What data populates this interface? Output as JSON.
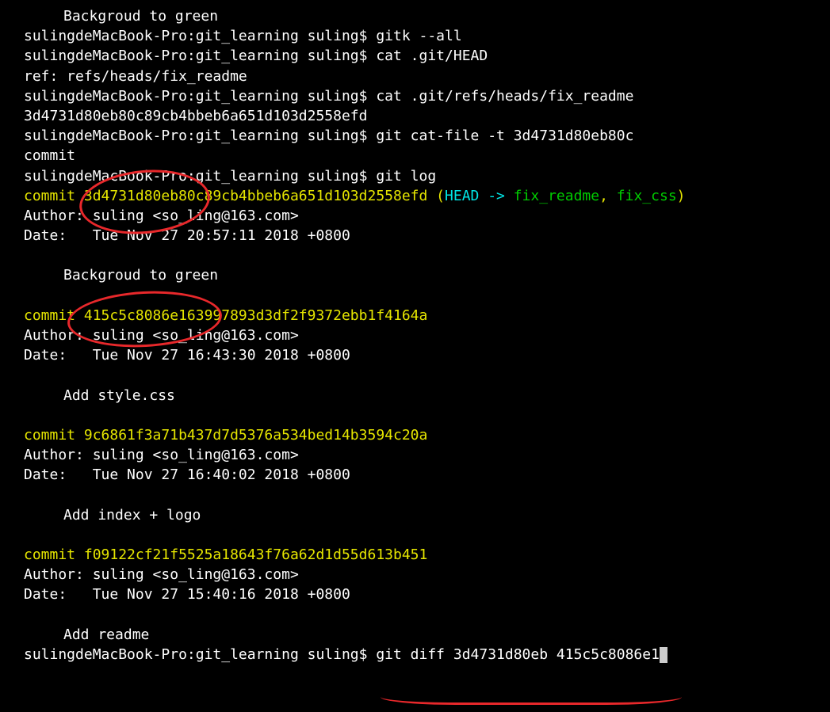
{
  "prompt": "sulingdeMacBook-Pro:git_learning suling$ ",
  "lines": {
    "l0_msg": "Backgroud to green",
    "l1_cmd": "gitk --all",
    "l2_cmd": "cat .git/HEAD",
    "l3": "ref: refs/heads/fix_readme",
    "l4_cmd": "cat .git/refs/heads/fix_readme",
    "l5": "3d4731d80eb80c89cb4bbeb6a651d103d2558efd",
    "l6_cmd": "git cat-file -t 3d4731d80eb80c",
    "l7": "commit",
    "l8_cmd": "git log"
  },
  "log": {
    "c1": {
      "prefix": "commit ",
      "hash": "3d4731d80eb80c89cb4bbeb6a651d103d2558efd",
      "decor_open": " (",
      "head": "HEAD -> ",
      "ref1": "fix_readme",
      "sep": ", ",
      "ref2": "fix_css",
      "decor_close": ")",
      "author": "Author: suling <so_ling@163.com>",
      "date": "Date:   Tue Nov 27 20:57:11 2018 +0800",
      "msg": "Backgroud to green"
    },
    "c2": {
      "line": "commit 415c5c8086e163997893d3df2f9372ebb1f4164a",
      "author": "Author: suling <so_ling@163.com>",
      "date": "Date:   Tue Nov 27 16:43:30 2018 +0800",
      "msg": "Add style.css"
    },
    "c3": {
      "line": "commit 9c6861f3a71b437d7d5376a534bed14b3594c20a",
      "author": "Author: suling <so_ling@163.com>",
      "date": "Date:   Tue Nov 27 16:40:02 2018 +0800",
      "msg": "Add index + logo"
    },
    "c4": {
      "line": "commit f09122cf21f5525a18643f76a62d1d55d613b451",
      "author": "Author: suling <so_ling@163.com>",
      "date": "Date:   Tue Nov 27 15:40:16 2018 +0800",
      "msg": "Add readme"
    }
  },
  "last_cmd": "git diff 3d4731d80eb 415c5c8086e1"
}
